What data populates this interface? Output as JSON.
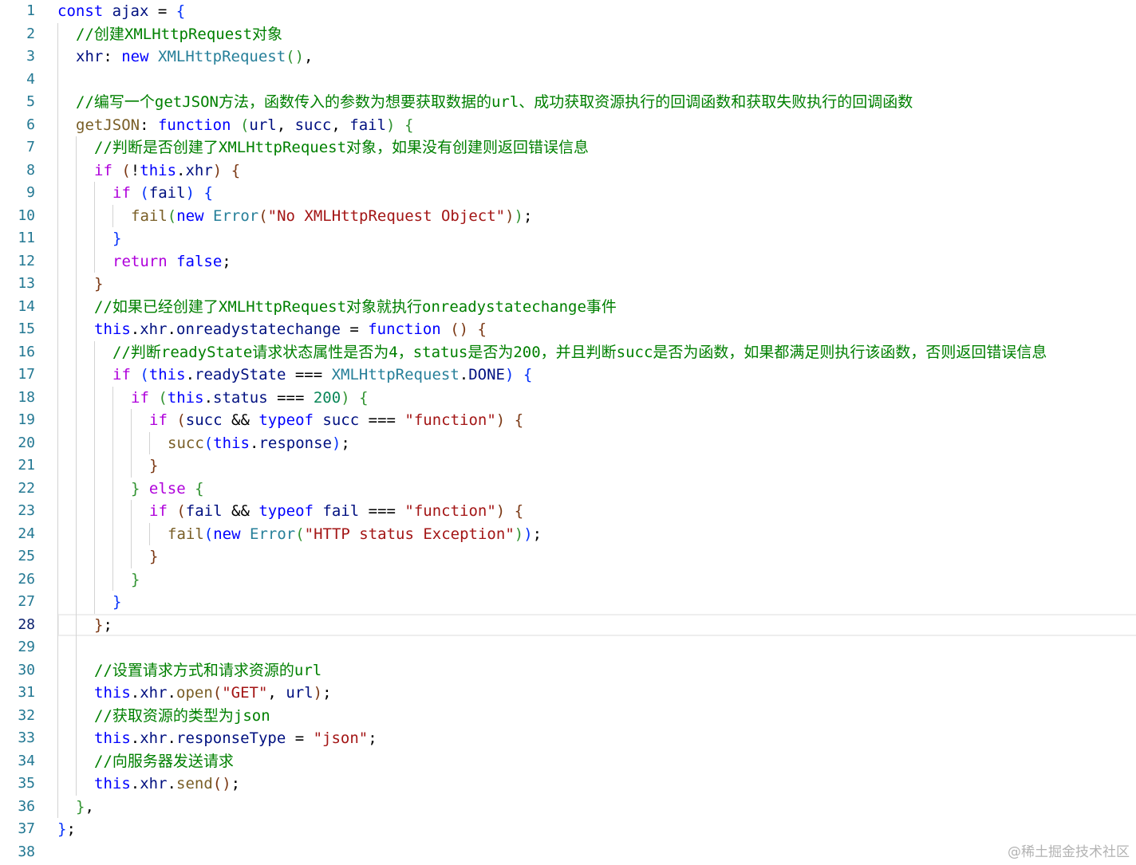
{
  "editor": {
    "current_line": 28,
    "lines": [
      {
        "n": "1",
        "indent": 0,
        "tokens": [
          [
            "kw",
            "const"
          ],
          [
            "p",
            " "
          ],
          [
            "var",
            "ajax"
          ],
          [
            "p",
            " = "
          ],
          [
            "b1",
            "{"
          ]
        ]
      },
      {
        "n": "2",
        "indent": 1,
        "tokens": [
          [
            "com",
            "//创建XMLHttpRequest对象"
          ]
        ]
      },
      {
        "n": "3",
        "indent": 1,
        "tokens": [
          [
            "var",
            "xhr"
          ],
          [
            "p",
            ": "
          ],
          [
            "kw",
            "new"
          ],
          [
            "p",
            " "
          ],
          [
            "type",
            "XMLHttpRequest"
          ],
          [
            "b2",
            "()"
          ],
          [
            "p",
            ","
          ]
        ]
      },
      {
        "n": "4",
        "indent": 1,
        "tokens": []
      },
      {
        "n": "5",
        "indent": 1,
        "tokens": [
          [
            "com",
            "//编写一个getJSON方法，函数传入的参数为想要获取数据的url、成功获取资源执行的回调函数和获取失败执行的回调函数"
          ]
        ]
      },
      {
        "n": "6",
        "indent": 1,
        "tokens": [
          [
            "fn",
            "getJSON"
          ],
          [
            "p",
            ": "
          ],
          [
            "kw",
            "function"
          ],
          [
            "p",
            " "
          ],
          [
            "b2",
            "("
          ],
          [
            "var",
            "url"
          ],
          [
            "p",
            ", "
          ],
          [
            "var",
            "succ"
          ],
          [
            "p",
            ", "
          ],
          [
            "var",
            "fail"
          ],
          [
            "b2",
            ")"
          ],
          [
            "p",
            " "
          ],
          [
            "b2",
            "{"
          ]
        ]
      },
      {
        "n": "7",
        "indent": 2,
        "tokens": [
          [
            "com",
            "//判断是否创建了XMLHttpRequest对象，如果没有创建则返回错误信息"
          ]
        ]
      },
      {
        "n": "8",
        "indent": 2,
        "tokens": [
          [
            "ctl",
            "if"
          ],
          [
            "p",
            " "
          ],
          [
            "b3",
            "("
          ],
          [
            "p",
            "!"
          ],
          [
            "kw",
            "this"
          ],
          [
            "p",
            "."
          ],
          [
            "var",
            "xhr"
          ],
          [
            "b3",
            ")"
          ],
          [
            "p",
            " "
          ],
          [
            "b3",
            "{"
          ]
        ]
      },
      {
        "n": "9",
        "indent": 3,
        "tokens": [
          [
            "ctl",
            "if"
          ],
          [
            "p",
            " "
          ],
          [
            "b1",
            "("
          ],
          [
            "var",
            "fail"
          ],
          [
            "b1",
            ")"
          ],
          [
            "p",
            " "
          ],
          [
            "b1",
            "{"
          ]
        ]
      },
      {
        "n": "10",
        "indent": 4,
        "tokens": [
          [
            "fn",
            "fail"
          ],
          [
            "b2",
            "("
          ],
          [
            "kw",
            "new"
          ],
          [
            "p",
            " "
          ],
          [
            "type",
            "Error"
          ],
          [
            "b3",
            "("
          ],
          [
            "str",
            "\"No XMLHttpRequest Object\""
          ],
          [
            "b3",
            ")"
          ],
          [
            "b2",
            ")"
          ],
          [
            "p",
            ";"
          ]
        ]
      },
      {
        "n": "11",
        "indent": 3,
        "tokens": [
          [
            "b1",
            "}"
          ]
        ]
      },
      {
        "n": "12",
        "indent": 3,
        "tokens": [
          [
            "ctl",
            "return"
          ],
          [
            "p",
            " "
          ],
          [
            "kw",
            "false"
          ],
          [
            "p",
            ";"
          ]
        ]
      },
      {
        "n": "13",
        "indent": 2,
        "tokens": [
          [
            "b3",
            "}"
          ]
        ]
      },
      {
        "n": "14",
        "indent": 2,
        "tokens": [
          [
            "com",
            "//如果已经创建了XMLHttpRequest对象就执行onreadystatechange事件"
          ]
        ]
      },
      {
        "n": "15",
        "indent": 2,
        "tokens": [
          [
            "kw",
            "this"
          ],
          [
            "p",
            "."
          ],
          [
            "var",
            "xhr"
          ],
          [
            "p",
            "."
          ],
          [
            "var",
            "onreadystatechange"
          ],
          [
            "p",
            " = "
          ],
          [
            "kw",
            "function"
          ],
          [
            "p",
            " "
          ],
          [
            "b3",
            "()"
          ],
          [
            "p",
            " "
          ],
          [
            "b3",
            "{"
          ]
        ]
      },
      {
        "n": "16",
        "indent": 3,
        "tokens": [
          [
            "com",
            "//判断readyState请求状态属性是否为4，status是否为200，并且判断succ是否为函数，如果都满足则执行该函数，否则返回错误信息"
          ]
        ]
      },
      {
        "n": "17",
        "indent": 3,
        "tokens": [
          [
            "ctl",
            "if"
          ],
          [
            "p",
            " "
          ],
          [
            "b1",
            "("
          ],
          [
            "kw",
            "this"
          ],
          [
            "p",
            "."
          ],
          [
            "var",
            "readyState"
          ],
          [
            "p",
            " === "
          ],
          [
            "type",
            "XMLHttpRequest"
          ],
          [
            "p",
            "."
          ],
          [
            "var",
            "DONE"
          ],
          [
            "b1",
            ")"
          ],
          [
            "p",
            " "
          ],
          [
            "b1",
            "{"
          ]
        ]
      },
      {
        "n": "18",
        "indent": 4,
        "tokens": [
          [
            "ctl",
            "if"
          ],
          [
            "p",
            " "
          ],
          [
            "b2",
            "("
          ],
          [
            "kw",
            "this"
          ],
          [
            "p",
            "."
          ],
          [
            "var",
            "status"
          ],
          [
            "p",
            " === "
          ],
          [
            "num",
            "200"
          ],
          [
            "b2",
            ")"
          ],
          [
            "p",
            " "
          ],
          [
            "b2",
            "{"
          ]
        ]
      },
      {
        "n": "19",
        "indent": 5,
        "tokens": [
          [
            "ctl",
            "if"
          ],
          [
            "p",
            " "
          ],
          [
            "b3",
            "("
          ],
          [
            "var",
            "succ"
          ],
          [
            "p",
            " && "
          ],
          [
            "kw",
            "typeof"
          ],
          [
            "p",
            " "
          ],
          [
            "var",
            "succ"
          ],
          [
            "p",
            " === "
          ],
          [
            "str",
            "\"function\""
          ],
          [
            "b3",
            ")"
          ],
          [
            "p",
            " "
          ],
          [
            "b3",
            "{"
          ]
        ]
      },
      {
        "n": "20",
        "indent": 6,
        "tokens": [
          [
            "fn",
            "succ"
          ],
          [
            "b1",
            "("
          ],
          [
            "kw",
            "this"
          ],
          [
            "p",
            "."
          ],
          [
            "var",
            "response"
          ],
          [
            "b1",
            ")"
          ],
          [
            "p",
            ";"
          ]
        ]
      },
      {
        "n": "21",
        "indent": 5,
        "tokens": [
          [
            "b3",
            "}"
          ]
        ]
      },
      {
        "n": "22",
        "indent": 4,
        "tokens": [
          [
            "b2",
            "}"
          ],
          [
            "p",
            " "
          ],
          [
            "ctl",
            "else"
          ],
          [
            "p",
            " "
          ],
          [
            "b2",
            "{"
          ]
        ]
      },
      {
        "n": "23",
        "indent": 5,
        "tokens": [
          [
            "ctl",
            "if"
          ],
          [
            "p",
            " "
          ],
          [
            "b3",
            "("
          ],
          [
            "var",
            "fail"
          ],
          [
            "p",
            " && "
          ],
          [
            "kw",
            "typeof"
          ],
          [
            "p",
            " "
          ],
          [
            "var",
            "fail"
          ],
          [
            "p",
            " === "
          ],
          [
            "str",
            "\"function\""
          ],
          [
            "b3",
            ")"
          ],
          [
            "p",
            " "
          ],
          [
            "b3",
            "{"
          ]
        ]
      },
      {
        "n": "24",
        "indent": 6,
        "tokens": [
          [
            "fn",
            "fail"
          ],
          [
            "b1",
            "("
          ],
          [
            "kw",
            "new"
          ],
          [
            "p",
            " "
          ],
          [
            "type",
            "Error"
          ],
          [
            "b2",
            "("
          ],
          [
            "str",
            "\"HTTP status Exception\""
          ],
          [
            "b2",
            ")"
          ],
          [
            "b1",
            ")"
          ],
          [
            "p",
            ";"
          ]
        ]
      },
      {
        "n": "25",
        "indent": 5,
        "tokens": [
          [
            "b3",
            "}"
          ]
        ]
      },
      {
        "n": "26",
        "indent": 4,
        "tokens": [
          [
            "b2",
            "}"
          ]
        ]
      },
      {
        "n": "27",
        "indent": 3,
        "tokens": [
          [
            "b1",
            "}"
          ]
        ]
      },
      {
        "n": "28",
        "indent": 2,
        "tokens": [
          [
            "b3",
            "}"
          ],
          [
            "p",
            ";"
          ]
        ]
      },
      {
        "n": "29",
        "indent": 2,
        "tokens": []
      },
      {
        "n": "30",
        "indent": 2,
        "tokens": [
          [
            "com",
            "//设置请求方式和请求资源的url"
          ]
        ]
      },
      {
        "n": "31",
        "indent": 2,
        "tokens": [
          [
            "kw",
            "this"
          ],
          [
            "p",
            "."
          ],
          [
            "var",
            "xhr"
          ],
          [
            "p",
            "."
          ],
          [
            "fn",
            "open"
          ],
          [
            "b3",
            "("
          ],
          [
            "str",
            "\"GET\""
          ],
          [
            "p",
            ", "
          ],
          [
            "var",
            "url"
          ],
          [
            "b3",
            ")"
          ],
          [
            "p",
            ";"
          ]
        ]
      },
      {
        "n": "32",
        "indent": 2,
        "tokens": [
          [
            "com",
            "//获取资源的类型为json"
          ]
        ]
      },
      {
        "n": "33",
        "indent": 2,
        "tokens": [
          [
            "kw",
            "this"
          ],
          [
            "p",
            "."
          ],
          [
            "var",
            "xhr"
          ],
          [
            "p",
            "."
          ],
          [
            "var",
            "responseType"
          ],
          [
            "p",
            " = "
          ],
          [
            "str",
            "\"json\""
          ],
          [
            "p",
            ";"
          ]
        ]
      },
      {
        "n": "34",
        "indent": 2,
        "tokens": [
          [
            "com",
            "//向服务器发送请求"
          ]
        ]
      },
      {
        "n": "35",
        "indent": 2,
        "tokens": [
          [
            "kw",
            "this"
          ],
          [
            "p",
            "."
          ],
          [
            "var",
            "xhr"
          ],
          [
            "p",
            "."
          ],
          [
            "fn",
            "send"
          ],
          [
            "b3",
            "()"
          ],
          [
            "p",
            ";"
          ]
        ]
      },
      {
        "n": "36",
        "indent": 1,
        "tokens": [
          [
            "b2",
            "}"
          ],
          [
            "p",
            ","
          ]
        ]
      },
      {
        "n": "37",
        "indent": 0,
        "tokens": [
          [
            "b1",
            "}"
          ],
          [
            "p",
            ";"
          ]
        ]
      },
      {
        "n": "38",
        "indent": 0,
        "tokens": []
      }
    ]
  },
  "watermark": "@稀土掘金技术社区"
}
